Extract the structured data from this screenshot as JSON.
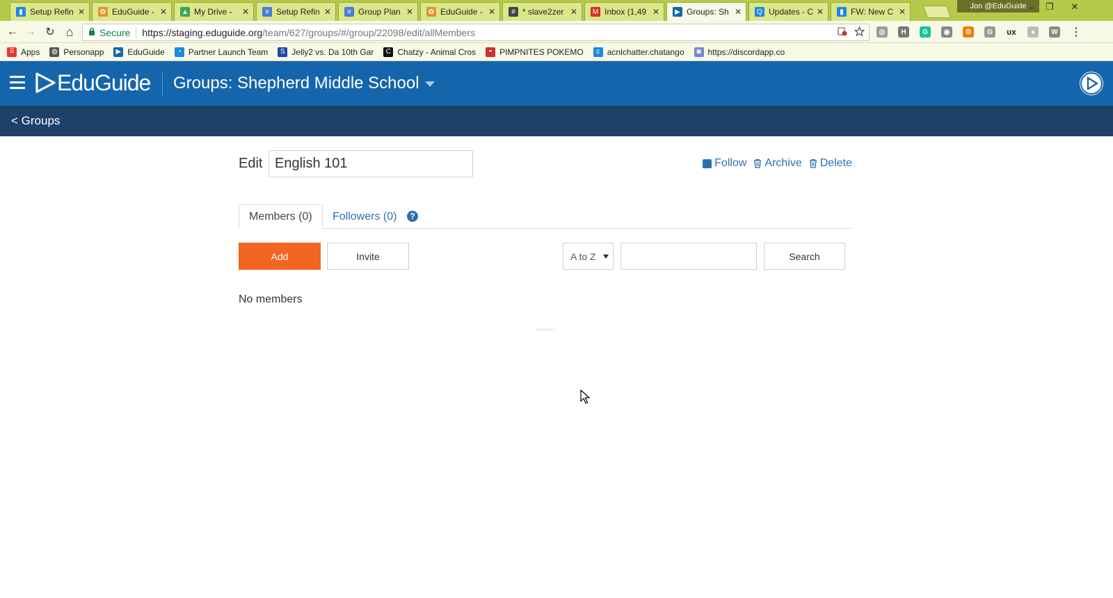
{
  "browser": {
    "tabs": [
      {
        "title": "Setup Refin",
        "color": "#1e88e5",
        "glyph": "▮"
      },
      {
        "title": "EduGuide -",
        "color": "#e0962e",
        "glyph": "✿"
      },
      {
        "title": "My Drive -",
        "color": "#3aa757",
        "glyph": "▲"
      },
      {
        "title": "Setup Refin",
        "color": "#4a7bd8",
        "glyph": "≡"
      },
      {
        "title": "Group Plan",
        "color": "#4a7bd8",
        "glyph": "≡"
      },
      {
        "title": "EduGuide -",
        "color": "#e0962e",
        "glyph": "✿"
      },
      {
        "title": "* slave2zer",
        "color": "#444444",
        "glyph": "#"
      },
      {
        "title": "Inbox (1,49",
        "color": "#d93025",
        "glyph": "M"
      },
      {
        "title": "Groups: Sh",
        "color": "#1565ac",
        "glyph": "▶"
      },
      {
        "title": "Updates - C",
        "color": "#1e88e5",
        "glyph": "Q"
      },
      {
        "title": "FW: New C",
        "color": "#1e88e5",
        "glyph": "▮"
      }
    ],
    "close_glyph": "✕",
    "profile": "Jon @EduGuide",
    "window_controls": {
      "minimize": "–",
      "restore": "❐",
      "close": "✕"
    },
    "nav": {
      "back": "←",
      "forward": "→",
      "reload": "↻",
      "home": "⌂"
    },
    "address": {
      "secure_label": "Secure",
      "url_host": "https://staging.eduguide.org",
      "url_path": "/team/627/groups/#/group/22098/edit/allMembers"
    },
    "extensions": [
      {
        "name": "globe-ext",
        "glyph": "◎",
        "color": "#9a9a9a"
      },
      {
        "name": "h-ext",
        "glyph": "H",
        "color": "#777777"
      },
      {
        "name": "grammarly-ext",
        "glyph": "G",
        "color": "#15c39a"
      },
      {
        "name": "camera-ext",
        "glyph": "◉",
        "color": "#888888"
      },
      {
        "name": "hubspot-ext",
        "glyph": "⚙",
        "color": "#f57c00"
      },
      {
        "name": "g-ext",
        "glyph": "G",
        "color": "#999999"
      },
      {
        "name": "ux-ext",
        "glyph": "ᴜx",
        "color": "#222222"
      },
      {
        "name": "circle-ext",
        "glyph": "●",
        "color": "#bbbbbb"
      },
      {
        "name": "w-ext",
        "glyph": "W",
        "color": "#888888"
      },
      {
        "name": "menu-ext",
        "glyph": "⋮",
        "color": "#555555"
      }
    ],
    "bookmarks": [
      {
        "label": "Apps",
        "color": "#e53935",
        "glyph": "⠿"
      },
      {
        "label": "Personapp",
        "color": "#555555",
        "glyph": "◍"
      },
      {
        "label": "EduGuide",
        "color": "#1565ac",
        "glyph": "▶"
      },
      {
        "label": "Partner Launch Team",
        "color": "#1e88e5",
        "glyph": "◔"
      },
      {
        "label": "Jelly2 vs. Da 10th Gar",
        "color": "#1e4aa8",
        "glyph": "S"
      },
      {
        "label": "Chatzy - Animal Cros",
        "color": "#111111",
        "glyph": "C"
      },
      {
        "label": "PIMPNITES POKEMO",
        "color": "#d32f2f",
        "glyph": "◓"
      },
      {
        "label": "acnlchatter.chatango",
        "color": "#1e88e5",
        "glyph": "c"
      },
      {
        "label": "https://discordapp.co",
        "color": "#7289da",
        "glyph": "◙"
      }
    ]
  },
  "app": {
    "logo_text": "EduGuide",
    "header_title": "Groups: Shepherd Middle School",
    "back_link": "< Groups",
    "brand_color": "#1565ac",
    "subheader_color": "#1e416a",
    "accent_color": "#f26522"
  },
  "group_edit": {
    "edit_label": "Edit",
    "group_name": "English 101",
    "actions": {
      "follow": "Follow",
      "archive": "Archive",
      "delete": "Delete"
    },
    "tabs": {
      "members": "Members (0)",
      "followers": "Followers (0)",
      "help": "?"
    },
    "buttons": {
      "add": "Add",
      "invite": "Invite",
      "search": "Search"
    },
    "sort": {
      "selected": "A to Z"
    },
    "search": {
      "value": "",
      "placeholder": ""
    },
    "empty_message": "No members"
  }
}
